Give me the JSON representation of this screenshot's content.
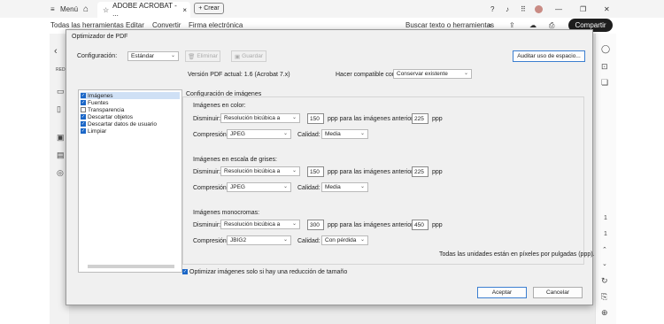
{
  "titlebar": {
    "menu_label": "Menú",
    "tab_title": "ADOBE ACROBAT - ...",
    "new_tab": "+ Crear"
  },
  "menubar": {
    "items": [
      "Todas las herramientas",
      "Editar",
      "Convertir",
      "Firma electrónica"
    ],
    "search": "Buscar texto o herramientas",
    "share": "Compartir"
  },
  "right_rail": {
    "page_num": "1",
    "page_total": "1"
  },
  "left_rail": {
    "label": "RED"
  },
  "dialog": {
    "title": "Optimizador de PDF",
    "config_label": "Configuración:",
    "config_value": "Estándar",
    "delete_label": "Eliminar",
    "save_label": "Guardar",
    "audit_label": "Auditar uso de espacio...",
    "version_text": "Versión PDF actual: 1.6 (Acrobat 7.x)",
    "compat_label": "Hacer compatible con:",
    "compat_value": "Conservar existente",
    "sidebar_items": [
      {
        "label": "Imágenes",
        "checked": true,
        "selected": true
      },
      {
        "label": "Fuentes",
        "checked": true
      },
      {
        "label": "Transparencia",
        "checked": false
      },
      {
        "label": "Descartar objetos",
        "checked": true
      },
      {
        "label": "Descartar datos de usuario",
        "checked": true
      },
      {
        "label": "Limpiar",
        "checked": true
      }
    ],
    "image_settings_title": "Configuración de imágenes",
    "sections": [
      {
        "title": "Imágenes en color:",
        "downsample_label": "Disminuir:",
        "downsample_value": "Resolución bicúbica a",
        "ppi_value": "150",
        "ppi_for_label": "ppp para las imágenes anteriores",
        "above_value": "225",
        "ppp_label": "ppp",
        "compression_label": "Compresión:",
        "compression_value": "JPEG",
        "quality_label": "Calidad:",
        "quality_value": "Media"
      },
      {
        "title": "Imágenes en escala de grises:",
        "downsample_label": "Disminuir:",
        "downsample_value": "Resolución bicúbica a",
        "ppi_value": "150",
        "ppi_for_label": "ppp para las imágenes anteriores",
        "above_value": "225",
        "ppp_label": "ppp",
        "compression_label": "Compresión:",
        "compression_value": "JPEG",
        "quality_label": "Calidad:",
        "quality_value": "Media"
      },
      {
        "title": "Imágenes monocromas:",
        "downsample_label": "Disminuir:",
        "downsample_value": "Resolución bicúbica a",
        "ppi_value": "300",
        "ppi_for_label": "ppp para las imágenes anteriores",
        "above_value": "450",
        "ppp_label": "ppp",
        "compression_label": "Compresión:",
        "compression_value": "JBIG2",
        "quality_label": "Calidad:",
        "quality_value": "Con pérdida"
      }
    ],
    "units_note": "Todas las unidades están en píxeles por pulgadas (ppp).",
    "optimize_only_label": "Optimizar imágenes solo si hay una reducción de tamaño",
    "optimize_only_checked": true,
    "accept_label": "Aceptar",
    "cancel_label": "Cancelar"
  },
  "colors": {
    "accent": "#1a66c7",
    "share_bg": "#1e1e1e"
  }
}
